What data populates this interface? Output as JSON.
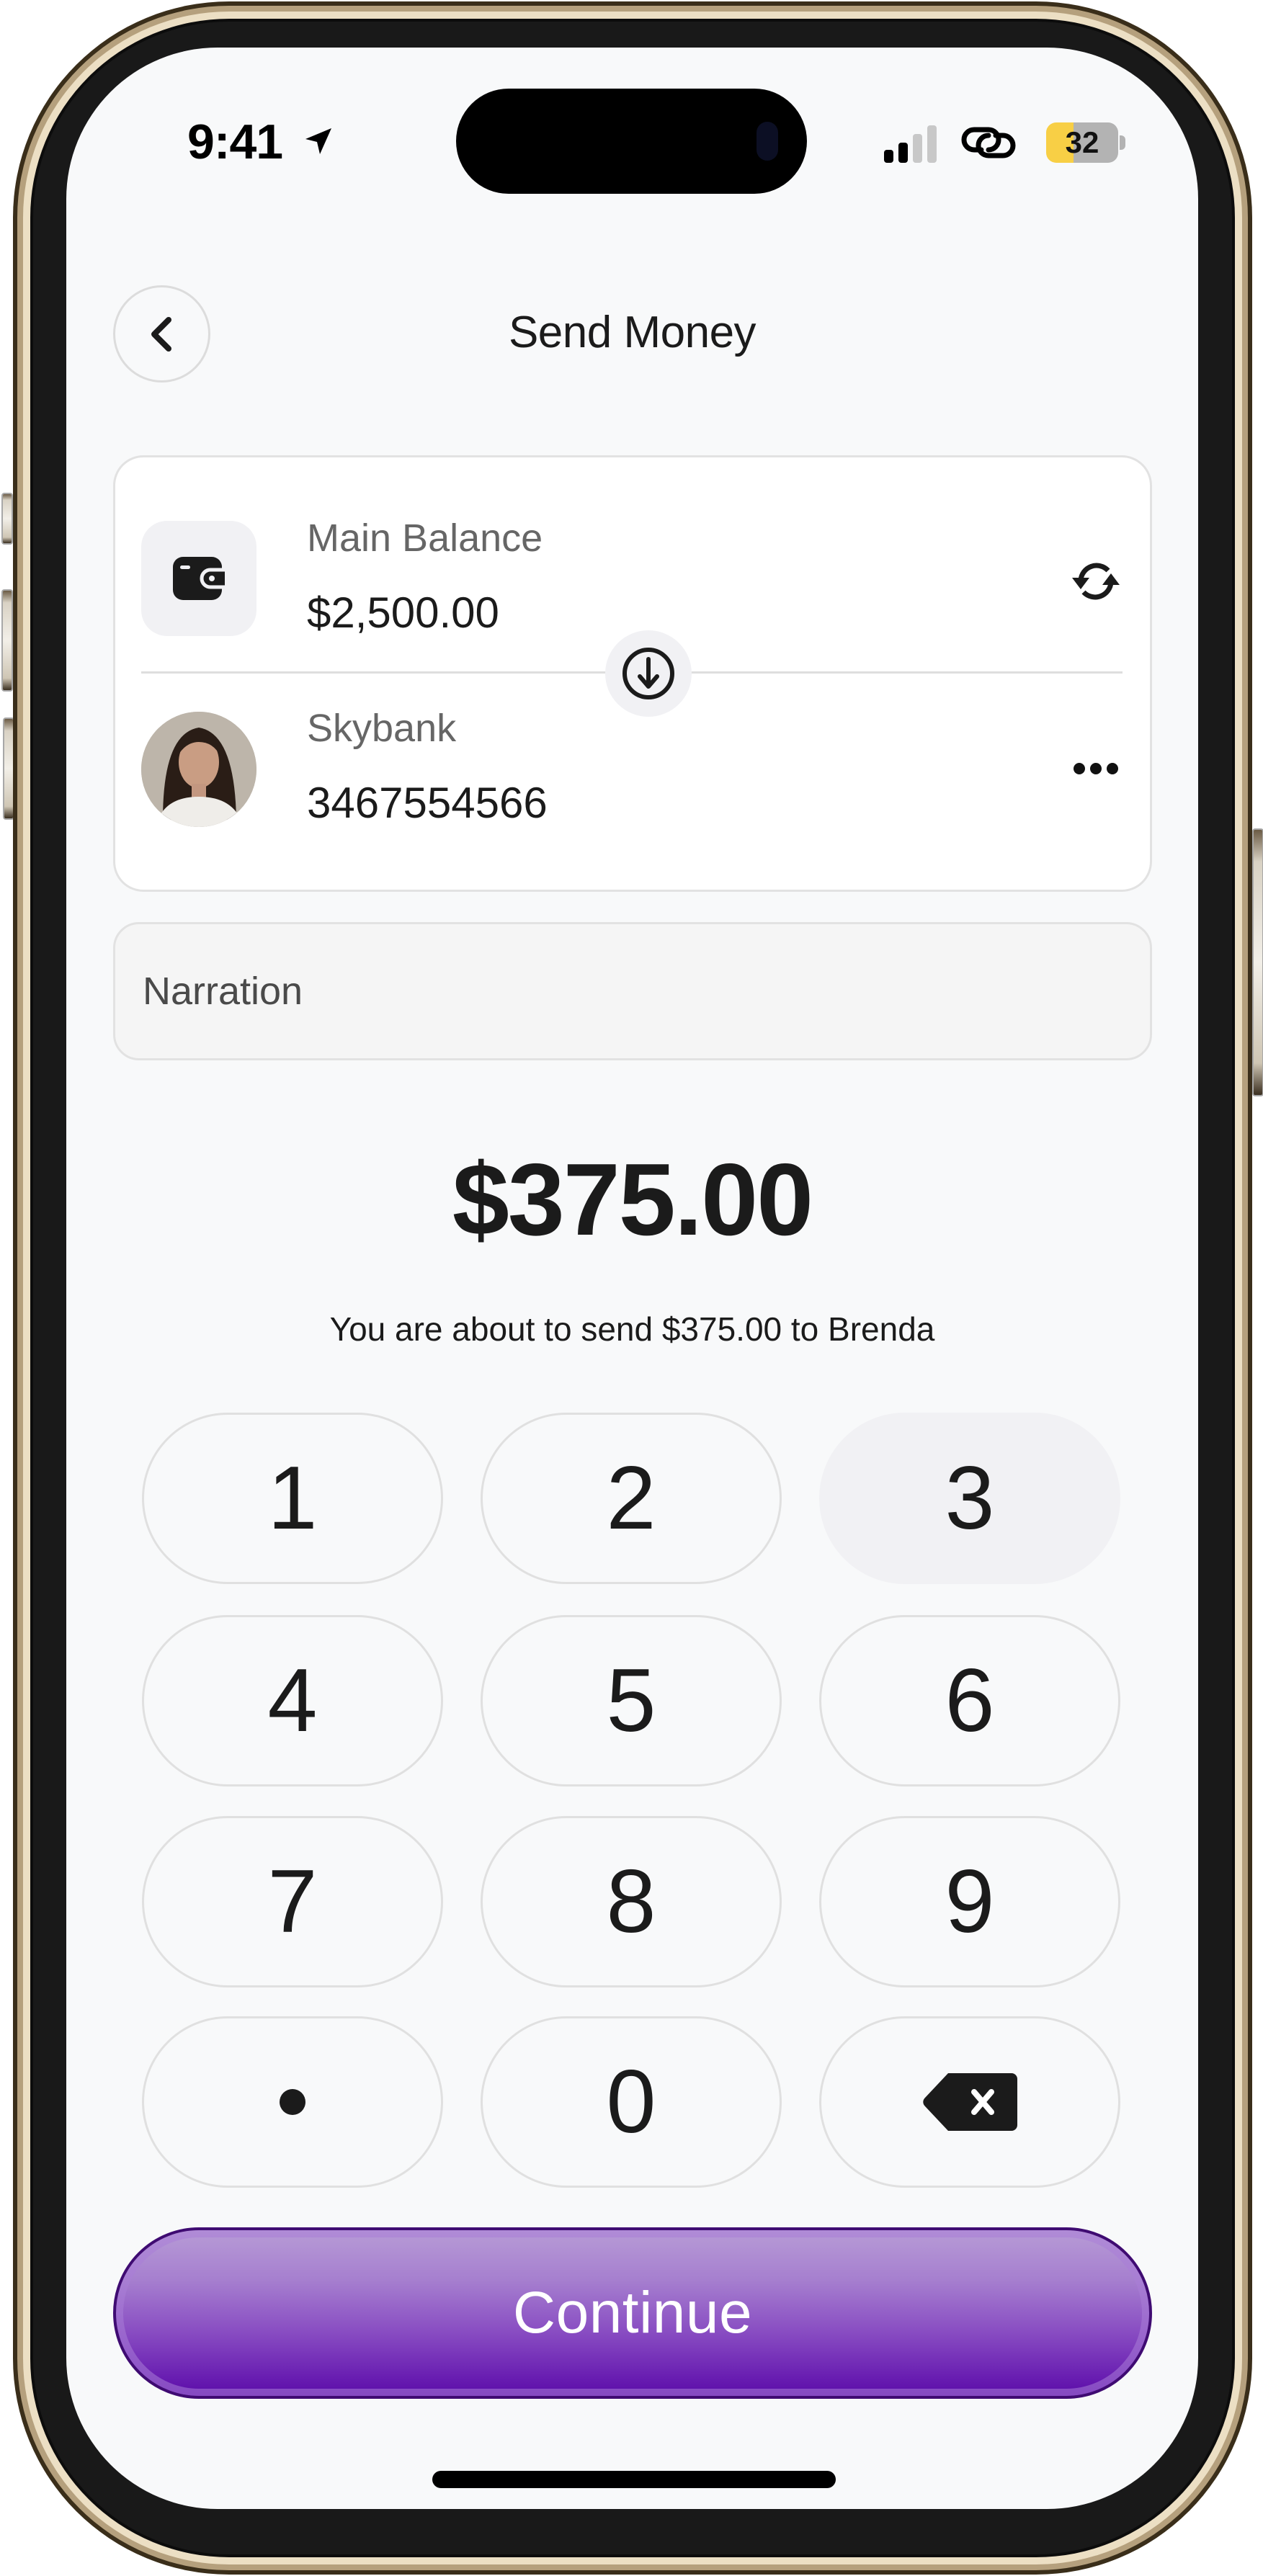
{
  "status_bar": {
    "time": "9:41",
    "location_icon": "location-arrow-icon",
    "signal_icon": "cellular-signal-icon",
    "link_icon": "link-icon",
    "battery_level": "32",
    "battery_color": "#f8cf45"
  },
  "header": {
    "back_icon": "chevron-left-icon",
    "title": "Send Money"
  },
  "transfer_card": {
    "source": {
      "icon": "wallet-icon",
      "label": "Main Balance",
      "value": "$2,500.00",
      "action_icon": "refresh-icon"
    },
    "swap_icon": "arrow-down-circle-icon",
    "recipient": {
      "avatar": "avatar-brenda",
      "bank": "Skybank",
      "account_number": "3467554566",
      "action_icon": "more-horizontal-icon"
    }
  },
  "narration": {
    "placeholder": "Narration",
    "value": ""
  },
  "amount": {
    "value": "$375.00",
    "note": "You are about to send $375.00 to Brenda"
  },
  "keypad": {
    "keys": [
      "1",
      "2",
      "3",
      "4",
      "5",
      "6",
      "7",
      "8",
      "9",
      "•",
      "0",
      "backspace"
    ],
    "pressed_key": "3",
    "backspace_icon": "backspace-icon"
  },
  "actions": {
    "continue_label": "Continue",
    "accent_color": "#6a1fb2"
  }
}
